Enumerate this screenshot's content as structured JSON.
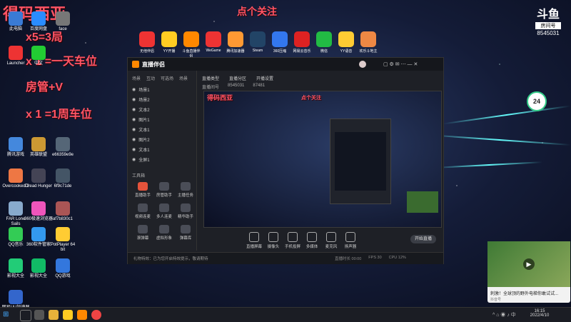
{
  "overlay": {
    "title_left": "得码西亚",
    "title_center": "点个关注",
    "lines": [
      "x5=3局",
      "x 1 =一天车位",
      "房管+V",
      "x 1 =1周车位"
    ]
  },
  "desktop_icons": [
    {
      "label": "此电脑",
      "color": "#3a7bd5"
    },
    {
      "label": "百度网盘",
      "color": "#2a8cff"
    },
    {
      "label": "face",
      "color": "#777"
    },
    {
      "label": "Launcher",
      "color": "#e33"
    },
    {
      "label": "中文",
      "color": "#2c3"
    },
    {
      "label": "腾讯游戏",
      "color": "#48d"
    },
    {
      "label": "英雄联盟",
      "color": "#c93"
    },
    {
      "label": "e66359e9e",
      "color": "#567"
    },
    {
      "label": "Overcooked 2",
      "color": "#e74"
    },
    {
      "label": "Dread Hunger",
      "color": "#445"
    },
    {
      "label": "6f9c71de",
      "color": "#456"
    },
    {
      "label": "FAR Lone Sails",
      "color": "#8ac"
    },
    {
      "label": "360极速浏览器",
      "color": "#e5b"
    },
    {
      "label": "af7b830c1",
      "color": "#a55"
    },
    {
      "label": "QQ音乐",
      "color": "#3c5"
    },
    {
      "label": "360软件管家",
      "color": "#39e"
    },
    {
      "label": "PotPlayer 64 bit",
      "color": "#fc3"
    },
    {
      "label": "影视大全",
      "color": "#2c7"
    },
    {
      "label": "影视大全",
      "color": "#1b6"
    },
    {
      "label": "QQ游戏",
      "color": "#37d"
    },
    {
      "label": "网易UU加速器",
      "color": "#36c"
    }
  ],
  "dock_icons": [
    {
      "label": "无他伴侣",
      "color": "#e33"
    },
    {
      "label": "YY开播",
      "color": "#fc2"
    },
    {
      "label": "斗鱼直播伴侣",
      "color": "#f80"
    },
    {
      "label": "WeGame",
      "color": "#e33"
    },
    {
      "label": "腾讯加速器",
      "color": "#f93"
    },
    {
      "label": "Steam",
      "color": "#246"
    },
    {
      "label": "360压缩",
      "color": "#37e"
    },
    {
      "label": "网易云音乐",
      "color": "#d22"
    },
    {
      "label": "微信",
      "color": "#2b4"
    },
    {
      "label": "YY语音",
      "color": "#fc3"
    },
    {
      "label": "欢乐斗地主",
      "color": "#e84"
    }
  ],
  "app": {
    "name": "直播伴侣",
    "room_label": "房间号",
    "room_number": "8545031",
    "brand": "斗鱼",
    "side_tabs": [
      "场景",
      "互动",
      "可选场",
      "场景"
    ],
    "scenes": [
      "场景1",
      "场景2",
      "文本2",
      "图片1",
      "文本1",
      "图片2",
      "文本1",
      "全屏1"
    ],
    "tools_header": "工具箱",
    "tools": [
      "直播助手",
      "房管助手",
      "主播任务",
      "视频连麦",
      "多人连麦",
      "精华助手",
      "滚弹幕",
      "虚拟形象",
      "弹幕库"
    ],
    "header_fields": [
      "直播类型",
      "直播分区",
      "开播设置"
    ],
    "stats": [
      "直播间号",
      "8545031",
      "87481"
    ],
    "bottom_buttons": [
      "直播屏幕",
      "摄像头",
      "手机投屏",
      "多媒体",
      "麦克风",
      "扬声器"
    ],
    "start_button": "开始直播",
    "status_text": "礼物特效：已为您开启特效提示，敬请期待",
    "footer": [
      "直播时长 00:00",
      "FPS 30",
      "CPU 12%"
    ]
  },
  "score_badge": "24",
  "video_popup": {
    "title": "刺激！全球顶的野外电梯你敢试试...",
    "source": "抖音号"
  },
  "taskbar": {
    "time": "16:15",
    "date": "2022/4/10"
  }
}
